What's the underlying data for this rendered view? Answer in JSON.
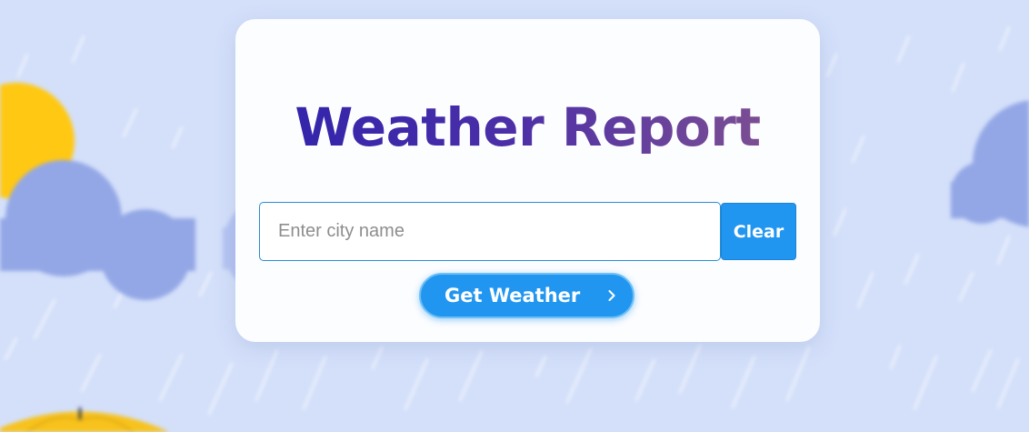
{
  "app": {
    "title": "Weather Report"
  },
  "search": {
    "placeholder": "Enter city name",
    "value": "",
    "clear_label": "Clear",
    "submit_label": "Get Weather"
  },
  "icons": {
    "submit_icon": "chevron-right-icon"
  },
  "colors": {
    "background": "#d4e0fa",
    "card": "#fcfdff",
    "accent": "#2196f0",
    "title_gradient_start": "#2d22ab",
    "title_gradient_end": "#86558e",
    "sun": "#ffc812",
    "cloud": "#93a7e6",
    "umbrella": "#f7c21c"
  }
}
